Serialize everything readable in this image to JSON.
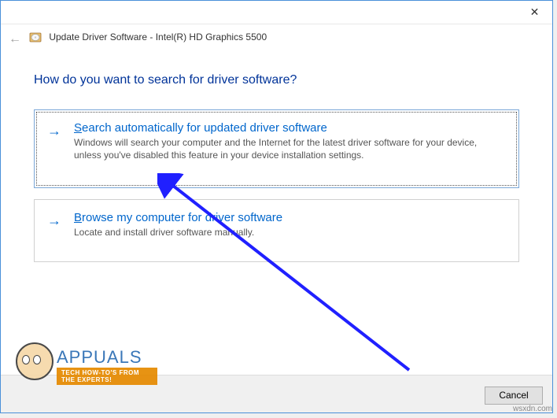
{
  "window": {
    "title": "Update Driver Software - Intel(R) HD Graphics 5500"
  },
  "heading": "How do you want to search for driver software?",
  "options": [
    {
      "mnemonic": "S",
      "title_rest": "earch automatically for updated driver software",
      "description": "Windows will search your computer and the Internet for the latest driver software for your device, unless you've disabled this feature in your device installation settings."
    },
    {
      "mnemonic": "B",
      "title_rest": "rowse my computer for driver software",
      "description": "Locate and install driver software manually."
    }
  ],
  "buttons": {
    "cancel": "Cancel"
  },
  "branding": {
    "name": "APPUALS",
    "tagline": "TECH HOW-TO'S FROM THE EXPERTS!",
    "watermark": "wsxdn.com"
  }
}
